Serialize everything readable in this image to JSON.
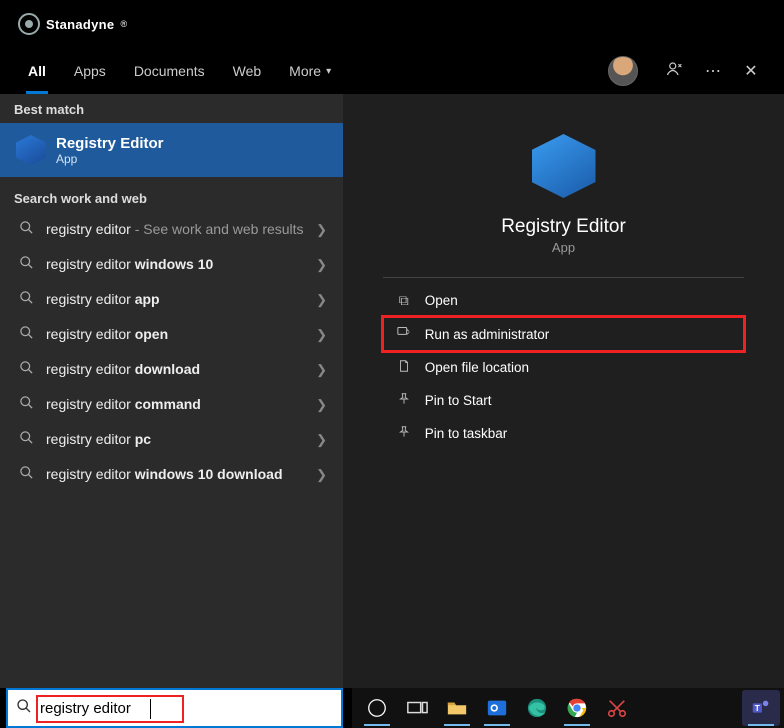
{
  "brand": "Stanadyne",
  "tabs": {
    "all": "All",
    "apps": "Apps",
    "documents": "Documents",
    "web": "Web",
    "more": "More"
  },
  "sections": {
    "best": "Best match",
    "sww": "Search work and web"
  },
  "bestMatch": {
    "title": "Registry Editor",
    "sub": "App"
  },
  "suggestions": [
    {
      "prefix": "registry editor",
      "bold": "",
      "suffix": " - See work and web results"
    },
    {
      "prefix": "registry editor ",
      "bold": "windows 10",
      "suffix": ""
    },
    {
      "prefix": "registry editor ",
      "bold": "app",
      "suffix": ""
    },
    {
      "prefix": "registry editor ",
      "bold": "open",
      "suffix": ""
    },
    {
      "prefix": "registry editor ",
      "bold": "download",
      "suffix": ""
    },
    {
      "prefix": "registry editor ",
      "bold": "command",
      "suffix": ""
    },
    {
      "prefix": "registry editor ",
      "bold": "pc",
      "suffix": ""
    },
    {
      "prefix": "registry editor ",
      "bold": "windows 10 download",
      "suffix": ""
    }
  ],
  "hero": {
    "title": "Registry Editor",
    "sub": "App"
  },
  "actions": {
    "open": "Open",
    "run_admin": "Run as administrator",
    "file_loc": "Open file location",
    "pin_start": "Pin to Start",
    "pin_tb": "Pin to taskbar"
  },
  "search": {
    "value": "registry editor"
  }
}
